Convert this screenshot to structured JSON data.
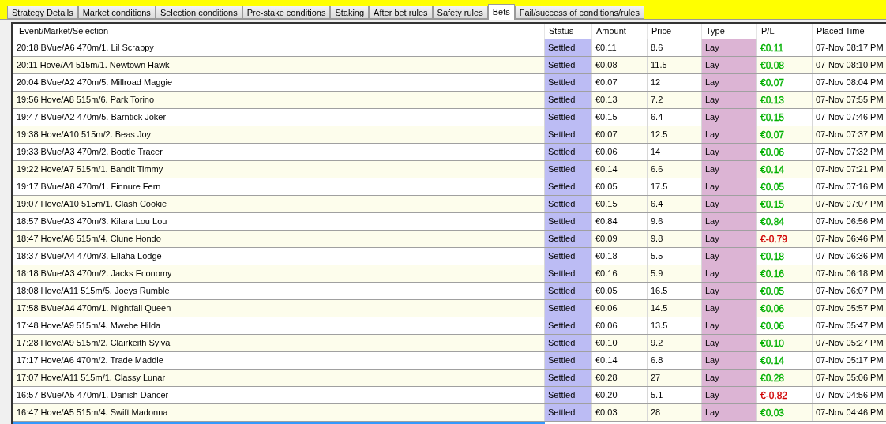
{
  "tabs": [
    {
      "label": "Strategy Details",
      "selected": false
    },
    {
      "label": "Market conditions",
      "selected": false
    },
    {
      "label": "Selection conditions",
      "selected": false
    },
    {
      "label": "Pre-stake conditions",
      "selected": false
    },
    {
      "label": "Staking",
      "selected": false
    },
    {
      "label": "After bet rules",
      "selected": false
    },
    {
      "label": "Safety rules",
      "selected": false
    },
    {
      "label": "Bets",
      "selected": true
    },
    {
      "label": "Fail/success of conditions/rules",
      "selected": false
    }
  ],
  "table": {
    "columns": [
      "Event/Market/Selection",
      "Status",
      "Amount",
      "Price",
      "Type",
      "P/L",
      "Placed Time"
    ],
    "rows": [
      {
        "cells": [
          "20:18 BVue/A6 470m/1. Lil Scrappy",
          "Settled",
          "€0.11",
          "8.6",
          "Lay",
          "€0.11",
          "07-Nov 08:17 PM"
        ],
        "color": "#00b000"
      },
      {
        "cells": [
          "20:11 Hove/A4 515m/1. Newtown Hawk",
          "Settled",
          "€0.08",
          "11.5",
          "Lay",
          "€0.08",
          "07-Nov 08:10 PM"
        ],
        "color": "#00b000"
      },
      {
        "cells": [
          "20:04 BVue/A2 470m/5. Millroad Maggie",
          "Settled",
          "€0.07",
          "12",
          "Lay",
          "€0.07",
          "07-Nov 08:04 PM"
        ],
        "color": "#00b000"
      },
      {
        "cells": [
          "19:56 Hove/A8 515m/6. Park Torino",
          "Settled",
          "€0.13",
          "7.2",
          "Lay",
          "€0.13",
          "07-Nov 07:55 PM"
        ],
        "color": "#00b000"
      },
      {
        "cells": [
          "19:47 BVue/A2 470m/5. Barntick Joker",
          "Settled",
          "€0.15",
          "6.4",
          "Lay",
          "€0.15",
          "07-Nov 07:46 PM"
        ],
        "color": "#00b000"
      },
      {
        "cells": [
          "19:38 Hove/A10 515m/2. Beas Joy",
          "Settled",
          "€0.07",
          "12.5",
          "Lay",
          "€0.07",
          "07-Nov 07:37 PM"
        ],
        "color": "#00b000"
      },
      {
        "cells": [
          "19:33 BVue/A3 470m/2. Bootle Tracer",
          "Settled",
          "€0.06",
          "14",
          "Lay",
          "€0.06",
          "07-Nov 07:32 PM"
        ],
        "color": "#00b000"
      },
      {
        "cells": [
          "19:22 Hove/A7 515m/1. Bandit Timmy",
          "Settled",
          "€0.14",
          "6.6",
          "Lay",
          "€0.14",
          "07-Nov 07:21 PM"
        ],
        "color": "#00b000"
      },
      {
        "cells": [
          "19:17 BVue/A8 470m/1. Finnure Fern",
          "Settled",
          "€0.05",
          "17.5",
          "Lay",
          "€0.05",
          "07-Nov 07:16 PM"
        ],
        "color": "#00b000"
      },
      {
        "cells": [
          "19:07 Hove/A10 515m/1. Clash Cookie",
          "Settled",
          "€0.15",
          "6.4",
          "Lay",
          "€0.15",
          "07-Nov 07:07 PM"
        ],
        "color": "#00b000"
      },
      {
        "cells": [
          "18:57 BVue/A3 470m/3. Kilara Lou Lou",
          "Settled",
          "€0.84",
          "9.6",
          "Lay",
          "€0.84",
          "07-Nov 06:56 PM"
        ],
        "color": "#00b000"
      },
      {
        "cells": [
          "18:47 Hove/A6 515m/4. Clune Hondo",
          "Settled",
          "€0.09",
          "9.8",
          "Lay",
          "€-0.79",
          "07-Nov 06:46 PM"
        ],
        "color": "#d00000"
      },
      {
        "cells": [
          "18:37 BVue/A4 470m/3. Ellaha Lodge",
          "Settled",
          "€0.18",
          "5.5",
          "Lay",
          "€0.18",
          "07-Nov 06:36 PM"
        ],
        "color": "#00b000"
      },
      {
        "cells": [
          "18:18 BVue/A3 470m/2. Jacks Economy",
          "Settled",
          "€0.16",
          "5.9",
          "Lay",
          "€0.16",
          "07-Nov 06:18 PM"
        ],
        "color": "#00b000"
      },
      {
        "cells": [
          "18:08 Hove/A11 515m/5. Joeys Rumble",
          "Settled",
          "€0.05",
          "16.5",
          "Lay",
          "€0.05",
          "07-Nov 06:07 PM"
        ],
        "color": "#00b000"
      },
      {
        "cells": [
          "17:58 BVue/A4 470m/1. Nightfall Queen",
          "Settled",
          "€0.06",
          "14.5",
          "Lay",
          "€0.06",
          "07-Nov 05:57 PM"
        ],
        "color": "#00b000"
      },
      {
        "cells": [
          "17:48 Hove/A9 515m/4. Mwebe Hilda",
          "Settled",
          "€0.06",
          "13.5",
          "Lay",
          "€0.06",
          "07-Nov 05:47 PM"
        ],
        "color": "#00b000"
      },
      {
        "cells": [
          "17:28 Hove/A9 515m/2. Clairkeith Sylva",
          "Settled",
          "€0.10",
          "9.2",
          "Lay",
          "€0.10",
          "07-Nov 05:27 PM"
        ],
        "color": "#00b000"
      },
      {
        "cells": [
          "17:17 Hove/A6 470m/2. Trade Maddie",
          "Settled",
          "€0.14",
          "6.8",
          "Lay",
          "€0.14",
          "07-Nov 05:17 PM"
        ],
        "color": "#00b000"
      },
      {
        "cells": [
          "17:07 Hove/A11 515m/1. Classy Lunar",
          "Settled",
          "€0.28",
          "27",
          "Lay",
          "€0.28",
          "07-Nov 05:06 PM"
        ],
        "color": "#00b000"
      },
      {
        "cells": [
          "16:57 BVue/A5 470m/1. Danish Dancer",
          "Settled",
          "€0.20",
          "5.1",
          "Lay",
          "€-0.82",
          "07-Nov 04:56 PM"
        ],
        "color": "#d00000"
      },
      {
        "cells": [
          "16:47 Hove/A5 515m/4. Swift Madonna",
          "Settled",
          "€0.03",
          "28",
          "Lay",
          "€0.03",
          "07-Nov 04:46 PM"
        ],
        "color": "#00b000"
      }
    ]
  }
}
